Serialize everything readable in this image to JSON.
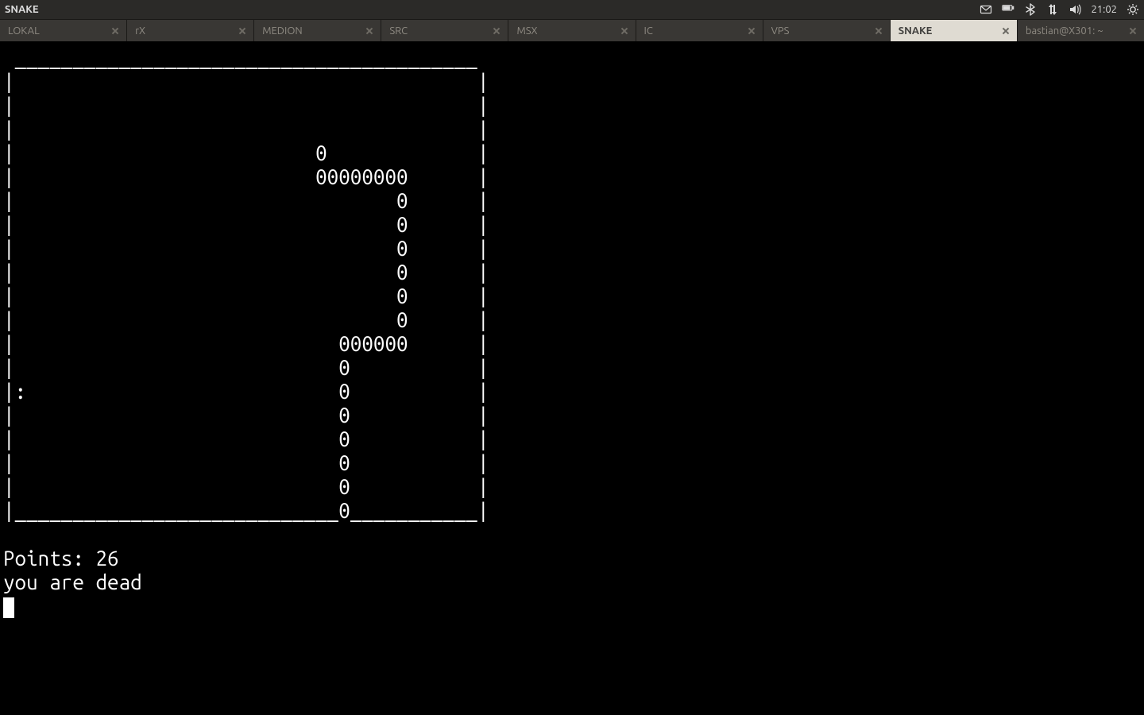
{
  "top_panel": {
    "app_title": "SNAKE",
    "clock": "21:02"
  },
  "tabs": [
    {
      "label": "LOKAL",
      "active": false
    },
    {
      "label": "rX",
      "active": false
    },
    {
      "label": "MEDION",
      "active": false
    },
    {
      "label": "SRC",
      "active": false
    },
    {
      "label": "MSX",
      "active": false
    },
    {
      "label": "IC",
      "active": false
    },
    {
      "label": "VPS",
      "active": false
    },
    {
      "label": "SNAKE",
      "active": true
    },
    {
      "label": "bastian@X301: ~",
      "active": false
    }
  ],
  "terminal_lines": [
    " ________________________________________",
    "|                                        |",
    "|                                        |",
    "|                                        |",
    "|                          0             |",
    "|                          00000000      |",
    "|                                 0      |",
    "|                                 0      |",
    "|                                 0      |",
    "|                                 0      |",
    "|                                 0      |",
    "|                                 0      |",
    "|                            000000      |",
    "|                            0           |",
    "|:                           0           |",
    "|                            0           |",
    "|                            0           |",
    "|                            0           |",
    "|                            0           |",
    "|____________________________0___________|",
    "",
    "Points: 26",
    "you are dead"
  ],
  "game": {
    "points_label": "Points:",
    "points_value": 26,
    "death_message": "you are dead",
    "food_char": ":",
    "snake_char": "0"
  }
}
